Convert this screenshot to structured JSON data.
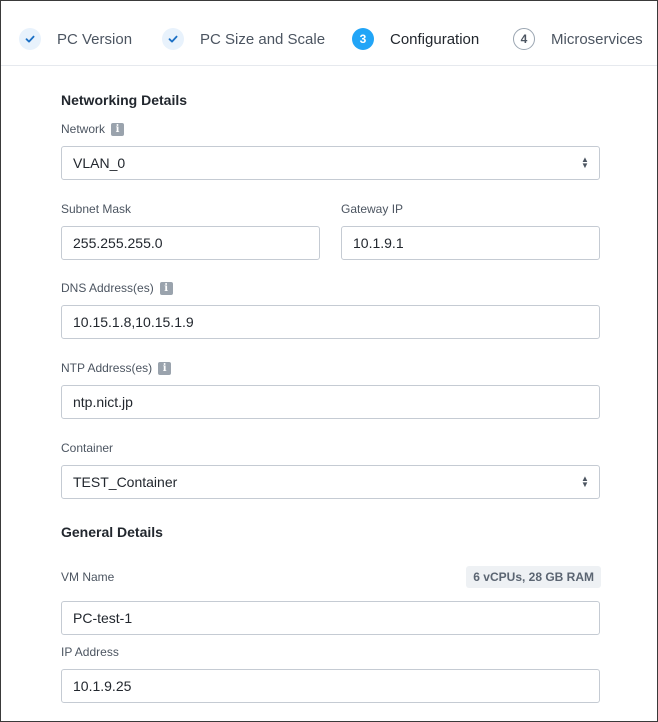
{
  "stepper": {
    "steps": [
      {
        "number": "",
        "label": "PC Version",
        "state": "done"
      },
      {
        "number": "",
        "label": "PC Size and Scale",
        "state": "done"
      },
      {
        "number": "3",
        "label": "Configuration",
        "state": "active"
      },
      {
        "number": "4",
        "label": "Microservices",
        "state": "todo"
      }
    ]
  },
  "networking": {
    "title": "Networking Details",
    "network": {
      "label": "Network",
      "value": "VLAN_0"
    },
    "subnet_mask": {
      "label": "Subnet Mask",
      "value": "255.255.255.0"
    },
    "gateway_ip": {
      "label": "Gateway IP",
      "value": "10.1.9.1"
    },
    "dns": {
      "label": "DNS Address(es)",
      "value": "10.15.1.8,10.15.1.9"
    },
    "ntp": {
      "label": "NTP Address(es)",
      "value": "ntp.nict.jp"
    },
    "container": {
      "label": "Container",
      "value": "TEST_Container"
    }
  },
  "general": {
    "title": "General Details",
    "vm_name": {
      "label": "VM Name",
      "value": "PC-test-1",
      "spec_chip": "6 vCPUs, 28 GB RAM"
    },
    "ip_address": {
      "label": "IP Address",
      "value": "10.1.9.25"
    }
  },
  "icons": {
    "info": "i",
    "check": "check-icon",
    "select_arrows": "select-arrows-icon"
  },
  "colors": {
    "active_step": "#22a5f7",
    "done_step_bg": "#e8f2fc",
    "check": "#1b70c5",
    "border": "#c5cbd3"
  }
}
